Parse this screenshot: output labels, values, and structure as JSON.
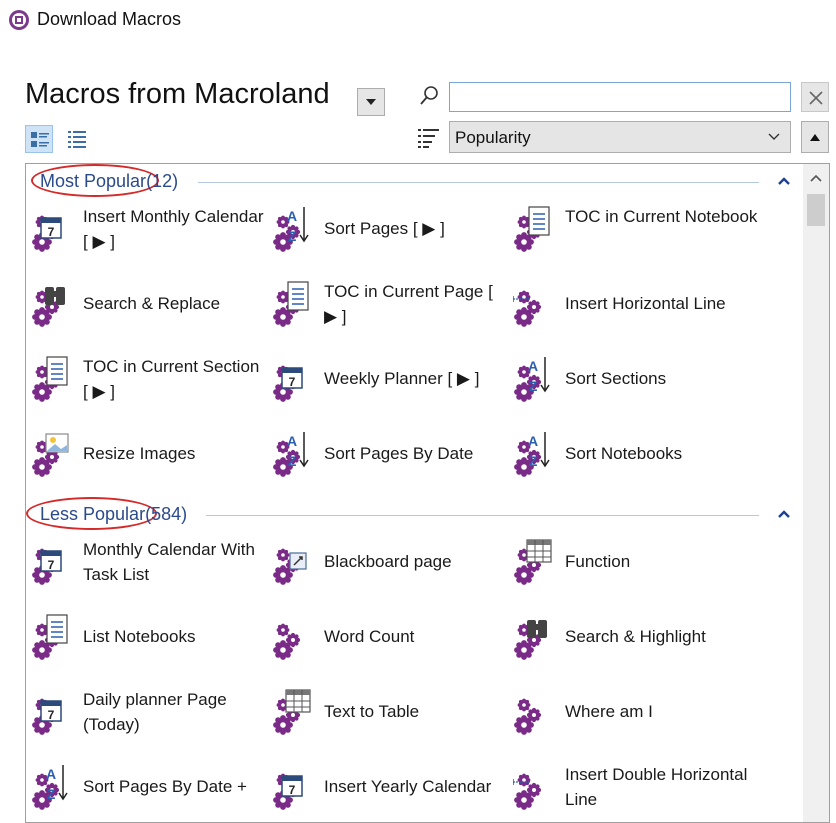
{
  "window": {
    "title": "Download Macros"
  },
  "header": {
    "title": "Macros from Macroland"
  },
  "search": {
    "value": "",
    "placeholder": ""
  },
  "sort": {
    "selected": "Popularity",
    "options": [
      "Popularity"
    ]
  },
  "colors": {
    "accent": "#2b4a8c",
    "gear": "#7a2a87",
    "highlight": "#d42a2a"
  },
  "groups": [
    {
      "name": "Most Popular",
      "count": "(12)",
      "items": [
        {
          "label": "Insert Monthly Calendar [ ▶ ]",
          "icon": "calendar-icon"
        },
        {
          "label": "Sort Pages [ ▶ ]",
          "icon": "sort-az-icon"
        },
        {
          "label": "TOC in Current Notebook",
          "icon": "document-list-icon"
        },
        {
          "label": "Search & Replace",
          "icon": "binoculars-icon"
        },
        {
          "label": "TOC in Current Page [ ▶ ]",
          "icon": "document-list-icon"
        },
        {
          "label": "Insert Horizontal Line",
          "icon": "horizontal-line-icon"
        },
        {
          "label": "TOC in Current Section [ ▶ ]",
          "icon": "document-list-icon"
        },
        {
          "label": "Weekly Planner [ ▶ ]",
          "icon": "calendar-icon"
        },
        {
          "label": "Sort Sections",
          "icon": "sort-az-icon"
        },
        {
          "label": "Resize Images",
          "icon": "image-icon"
        },
        {
          "label": "Sort Pages By Date",
          "icon": "sort-az-icon"
        },
        {
          "label": "Sort Notebooks",
          "icon": "sort-az-icon"
        }
      ]
    },
    {
      "name": "Less Popular",
      "count": "(584)",
      "items": [
        {
          "label": "Monthly Calendar With Task List",
          "icon": "calendar-icon"
        },
        {
          "label": "Blackboard page",
          "icon": "blackboard-icon"
        },
        {
          "label": "Function",
          "icon": "table-icon"
        },
        {
          "label": "List Notebooks",
          "icon": "document-list-icon"
        },
        {
          "label": "Word Count",
          "icon": "gear-icon"
        },
        {
          "label": "Search & Highlight",
          "icon": "binoculars-icon"
        },
        {
          "label": "Daily planner Page (Today)",
          "icon": "calendar-icon"
        },
        {
          "label": "Text to Table",
          "icon": "table-icon"
        },
        {
          "label": "Where am I",
          "icon": "gear-icon"
        },
        {
          "label": "Sort Pages By Date +",
          "icon": "sort-az-icon"
        },
        {
          "label": "Insert Yearly Calendar",
          "icon": "calendar-icon"
        },
        {
          "label": "Insert Double Horizontal Line",
          "icon": "horizontal-line-icon"
        }
      ]
    }
  ]
}
